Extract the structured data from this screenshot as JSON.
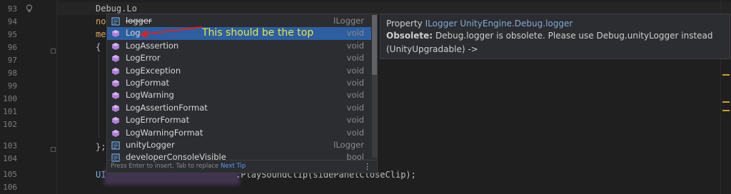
{
  "gutter": {
    "line_numbers": [
      "93",
      "94",
      "95",
      "96",
      "97",
      "98",
      "99",
      "100",
      "101",
      "102",
      "103",
      "104",
      "105",
      "106"
    ]
  },
  "code": {
    "typed_line": "Debug.Lo",
    "line94_prefix": "no",
    "line95_prefix": "me",
    "line96": "{",
    "line103": "};",
    "line105_start": "UI",
    "line105_tail": ".PlaySoundClip(sidePanelCloseClip);"
  },
  "completion": {
    "items": [
      {
        "label": "logger",
        "type": "ILogger",
        "icon": "property-icon"
      },
      {
        "label": "Log",
        "type": "void",
        "icon": "method-icon"
      },
      {
        "label": "LogAssertion",
        "type": "void",
        "icon": "method-icon"
      },
      {
        "label": "LogError",
        "type": "void",
        "icon": "method-icon"
      },
      {
        "label": "LogException",
        "type": "void",
        "icon": "method-icon"
      },
      {
        "label": "LogFormat",
        "type": "void",
        "icon": "method-icon"
      },
      {
        "label": "LogWarning",
        "type": "void",
        "icon": "method-icon"
      },
      {
        "label": "LogAssertionFormat",
        "type": "void",
        "icon": "method-icon"
      },
      {
        "label": "LogErrorFormat",
        "type": "void",
        "icon": "method-icon"
      },
      {
        "label": "LogWarningFormat",
        "type": "void",
        "icon": "method-icon"
      },
      {
        "label": "unityLogger",
        "type": "ILogger",
        "icon": "property-icon"
      },
      {
        "label": "developerConsoleVisible",
        "type": "bool",
        "icon": "property-icon"
      }
    ],
    "footer_hint": "Press Enter to insert, Tab to replace",
    "footer_tip": "Next Tip",
    "footer_more": "⋮"
  },
  "doc": {
    "prefix": "Property",
    "signature": "ILogger UnityEngine.Debug.logger",
    "obsolete_label": "Obsolete:",
    "obsolete_text": "Debug.logger is obsolete. Please use Debug.unityLogger instead",
    "note": "(UnityUpgradable) ->"
  },
  "annotation": {
    "text": "This should be the top",
    "color": "#e6e84a",
    "arrow_color": "#e02020"
  },
  "colors": {
    "selection": "#2d5ea0",
    "method_icon": "#b07fd8",
    "property_icon": "#6aa9e8"
  }
}
